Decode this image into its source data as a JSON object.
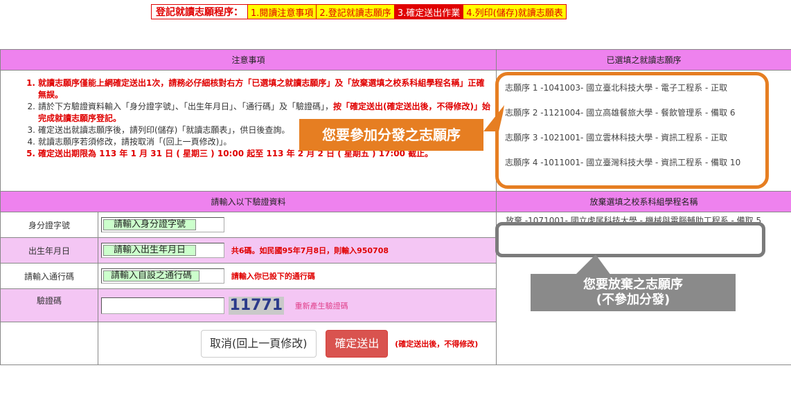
{
  "steps": {
    "title": "登記就讀志願程序：",
    "s1": "1.閱讀注意事項",
    "s2": "2.登記就讀志願序",
    "s3": "3.確定送出作業",
    "s4": "4.列印(儲存)就讀志願表"
  },
  "headers": {
    "notes": "注意事項",
    "selected": "已選填之就讀志願序",
    "verify": "請輸入以下驗證資料",
    "abandon": "放棄選填之校系科組學程名稱"
  },
  "notes": [
    {
      "num": "1.",
      "a": "就讀志願序僅能上網確定送出1次，請務必仔細核對右方「已選填之就讀志願序」及「放棄選填之校系科組學程名稱」正確無誤。",
      "b": "",
      "c": ""
    },
    {
      "num": "2.",
      "a": "請於下方驗證資料輸入「身分證字號」、「出生年月日」、「通行碼」及「驗證碼」，",
      "b": "按「確定送出(確定送出後，不得修改)」始完成就讀志願序登記。",
      "c": ""
    },
    {
      "num": "3.",
      "a": "確定送出就讀志願序後，請列印(儲存)「就讀志願表」，供日後查詢。",
      "b": "",
      "c": ""
    },
    {
      "num": "4.",
      "a": "就讀志願序若須修改，請按取消「(回上一頁修改)」。",
      "b": "",
      "c": ""
    },
    {
      "num": "5.",
      "a": "確定送出期限為 113 年 1 月 31 日 ( 星期三 ) 10:00 起至 113 年 2 月 2 日 ( 星期五 ) 17:00 截止。",
      "b": "",
      "c": ""
    }
  ],
  "selected": [
    "志願序 1 -1041003- 國立臺北科技大學 - 電子工程系 - 正取",
    "志願序 2 -1121004- 國立高雄餐旅大學 - 餐飲管理系 - 備取 6",
    "志願序 3 -1021001- 國立雲林科技大學 - 資訊工程系 - 正取",
    "志願序 4 -1011001- 國立臺灣科技大學 - 資訊工程系 - 備取 10"
  ],
  "form": {
    "id_label": "身分證字號",
    "id_value": "請輸入身分證字號",
    "birth_label": "出生年月日",
    "birth_value": "請輸入出生年月日",
    "birth_hint": "共6碼。如民國95年7月8日，則輸入950708",
    "pass_label": "請輸入通行碼",
    "pass_value": "請輸入自設之通行碼",
    "pass_hint": "請輸入你已設下的通行碼",
    "captcha_label": "驗證碼",
    "captcha_value": "",
    "captcha_code": "11771",
    "regen_label": "重新產生驗證碼",
    "cancel_label": "取消(回上一頁修改)",
    "submit_label": "確定送出",
    "submit_hint": "(確定送出後，不得修改)"
  },
  "abandon": [
    "放棄 -1071001- 國立虎尾科技大學 - 機械與電腦輔助工程系 - 備取 5"
  ],
  "annotations": {
    "orange": "您要參加分發之志願序",
    "gray_line1": "您要放棄之志願序",
    "gray_line2": "(不參加分發)"
  },
  "colors": {
    "header_bg": "#ee82ee",
    "pink_row": "#f4c6f4",
    "accent_red": "#e00000",
    "highlight_yellow": "#ffff00",
    "orange": "#e67e22",
    "gray": "#8a8a8a",
    "submit_btn": "#d9534f"
  }
}
